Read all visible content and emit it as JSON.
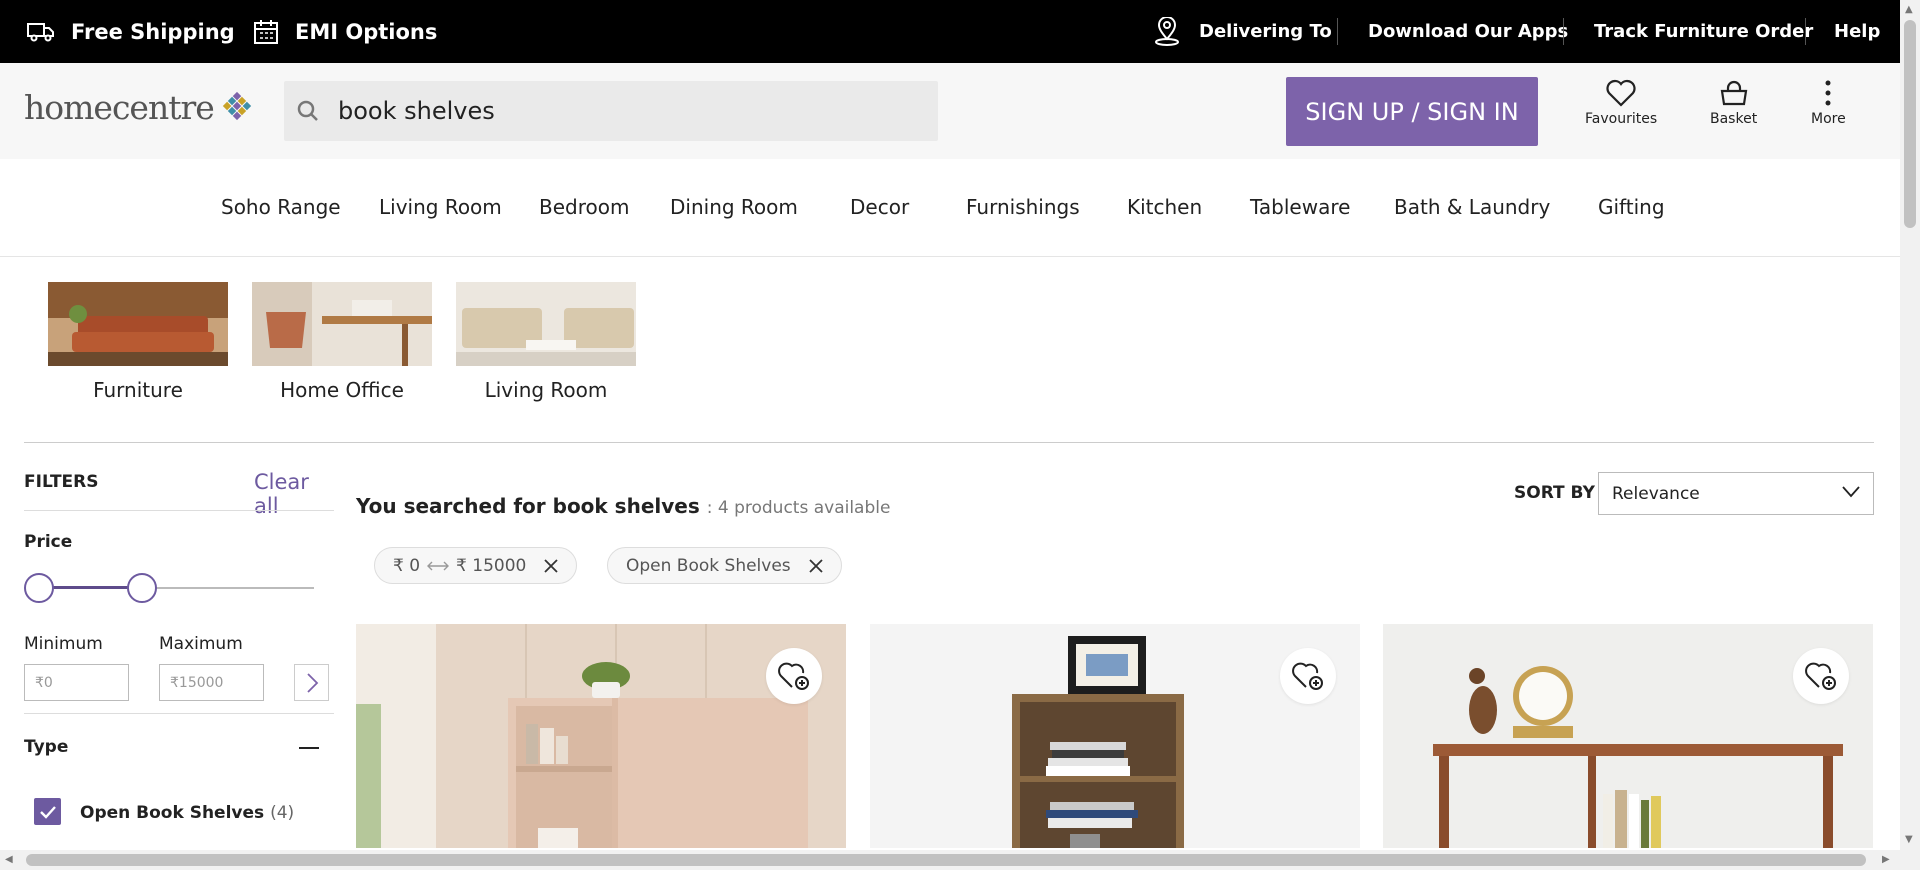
{
  "topbar": {
    "free_shipping": "Free Shipping",
    "emi_options": "EMI Options",
    "delivering_to": "Delivering To",
    "download_apps": "Download Our Apps",
    "track_order": "Track Furniture Order",
    "help": "Help"
  },
  "header": {
    "logo_text": "homecentre",
    "search_value": "book shelves",
    "signin_label": "SIGN UP / SIGN IN",
    "favourites_label": "Favourites",
    "basket_label": "Basket",
    "more_label": "More"
  },
  "nav": {
    "items": [
      "Soho Range",
      "Living Room",
      "Bedroom",
      "Dining Room",
      "Decor",
      "Furnishings",
      "Kitchen",
      "Tableware",
      "Bath & Laundry",
      "Gifting"
    ]
  },
  "categories": [
    "Furniture",
    "Home Office",
    "Living Room"
  ],
  "filters": {
    "title": "FILTERS",
    "clear_all": "Clear all",
    "price_label": "Price",
    "minimum_label": "Minimum",
    "maximum_label": "Maximum",
    "min_placeholder": "₹0",
    "max_placeholder": "₹15000",
    "type_label": "Type",
    "type_option": "Open Book Shelves",
    "type_option_count": "(4)"
  },
  "results": {
    "title": "You searched for book shelves",
    "count": ": 4 products available",
    "sort_label": "SORT BY",
    "sort_value": "Relevance",
    "chip_price_min": "₹ 0",
    "chip_price_max": "₹ 15000",
    "chip_type": "Open Book Shelves"
  },
  "colors": {
    "accent": "#7d63aa",
    "topbar_bg": "#000000",
    "header_bg": "#f7f7f7"
  },
  "icons": [
    "truck-icon",
    "calendar-icon",
    "location-pin-icon",
    "search-icon",
    "heart-icon",
    "basket-icon",
    "more-dots-icon",
    "chevron-right-icon",
    "chevron-down-icon",
    "close-icon",
    "check-icon",
    "heart-plus-icon"
  ]
}
